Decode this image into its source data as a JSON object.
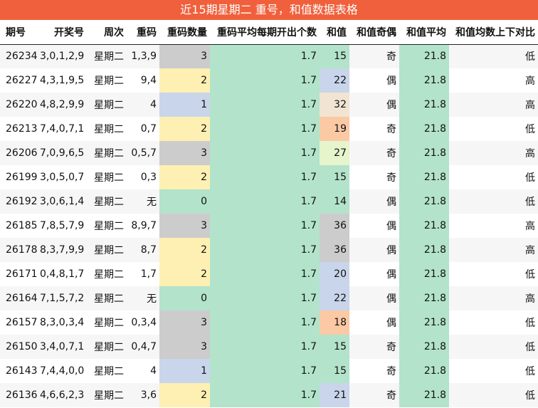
{
  "title": "近15期星期二 重号，和值数据表格",
  "headers": [
    "期号",
    "开奖号",
    "周次",
    "重码",
    "重码数量",
    "重码平均每期开出个数",
    "和值",
    "和值奇偶",
    "和值平均",
    "和值均数上下对比"
  ],
  "colors": {
    "title_bg": "#f0603c",
    "count_0": "#b3e3cb",
    "count_1": "#c9d5ea",
    "count_2": "#fdf0b2",
    "count_3": "#cccccc",
    "avg": "#b3e3cb"
  },
  "rows": [
    {
      "issue": "26234",
      "numbers": "3,0,1,2,9",
      "weekday": "星期二",
      "repeat": "1,3,9",
      "repeat_count": "3",
      "count_color": "#cccccc",
      "avg_count": "1.7",
      "sum": "15",
      "sum_color": "#b3e3cb",
      "parity": "奇",
      "sum_avg": "21.8",
      "compare": "低"
    },
    {
      "issue": "26227",
      "numbers": "4,3,1,9,5",
      "weekday": "星期二",
      "repeat": "9,4",
      "repeat_count": "2",
      "count_color": "#fdf0b2",
      "avg_count": "1.7",
      "sum": "22",
      "sum_color": "#c9d5ea",
      "parity": "偶",
      "sum_avg": "21.8",
      "compare": "高"
    },
    {
      "issue": "26220",
      "numbers": "4,8,2,9,9",
      "weekday": "星期二",
      "repeat": "4",
      "repeat_count": "1",
      "count_color": "#c9d5ea",
      "avg_count": "1.7",
      "sum": "32",
      "sum_color": "#f2e4d2",
      "parity": "偶",
      "sum_avg": "21.8",
      "compare": "高"
    },
    {
      "issue": "26213",
      "numbers": "7,4,0,7,1",
      "weekday": "星期二",
      "repeat": "0,7",
      "repeat_count": "2",
      "count_color": "#fdf0b2",
      "avg_count": "1.7",
      "sum": "19",
      "sum_color": "#fbc9a4",
      "parity": "奇",
      "sum_avg": "21.8",
      "compare": "低"
    },
    {
      "issue": "26206",
      "numbers": "7,0,9,6,5",
      "weekday": "星期二",
      "repeat": "0,5,7",
      "repeat_count": "3",
      "count_color": "#cccccc",
      "avg_count": "1.7",
      "sum": "27",
      "sum_color": "#e6f5cc",
      "parity": "奇",
      "sum_avg": "21.8",
      "compare": "高"
    },
    {
      "issue": "26199",
      "numbers": "3,0,5,0,7",
      "weekday": "星期二",
      "repeat": "0,3",
      "repeat_count": "2",
      "count_color": "#fdf0b2",
      "avg_count": "1.7",
      "sum": "15",
      "sum_color": "#b3e3cb",
      "parity": "奇",
      "sum_avg": "21.8",
      "compare": "低"
    },
    {
      "issue": "26192",
      "numbers": "3,0,6,1,4",
      "weekday": "星期二",
      "repeat": "无",
      "repeat_count": "0",
      "count_color": "#b3e3cb",
      "avg_count": "1.7",
      "sum": "14",
      "sum_color": "#b3e3cb",
      "parity": "偶",
      "sum_avg": "21.8",
      "compare": "低"
    },
    {
      "issue": "26185",
      "numbers": "7,8,5,7,9",
      "weekday": "星期二",
      "repeat": "8,9,7",
      "repeat_count": "3",
      "count_color": "#cccccc",
      "avg_count": "1.7",
      "sum": "36",
      "sum_color": "#cccccc",
      "parity": "偶",
      "sum_avg": "21.8",
      "compare": "高"
    },
    {
      "issue": "26178",
      "numbers": "8,3,7,9,9",
      "weekday": "星期二",
      "repeat": "8,7",
      "repeat_count": "2",
      "count_color": "#fdf0b2",
      "avg_count": "1.7",
      "sum": "36",
      "sum_color": "#cccccc",
      "parity": "偶",
      "sum_avg": "21.8",
      "compare": "高"
    },
    {
      "issue": "26171",
      "numbers": "0,4,8,1,7",
      "weekday": "星期二",
      "repeat": "1,7",
      "repeat_count": "2",
      "count_color": "#fdf0b2",
      "avg_count": "1.7",
      "sum": "20",
      "sum_color": "#c9d5ea",
      "parity": "偶",
      "sum_avg": "21.8",
      "compare": "低"
    },
    {
      "issue": "26164",
      "numbers": "7,1,5,7,2",
      "weekday": "星期二",
      "repeat": "无",
      "repeat_count": "0",
      "count_color": "#b3e3cb",
      "avg_count": "1.7",
      "sum": "22",
      "sum_color": "#c9d5ea",
      "parity": "偶",
      "sum_avg": "21.8",
      "compare": "高"
    },
    {
      "issue": "26157",
      "numbers": "8,3,0,3,4",
      "weekday": "星期二",
      "repeat": "0,3,4",
      "repeat_count": "3",
      "count_color": "#cccccc",
      "avg_count": "1.7",
      "sum": "18",
      "sum_color": "#fbc9a4",
      "parity": "偶",
      "sum_avg": "21.8",
      "compare": "低"
    },
    {
      "issue": "26150",
      "numbers": "3,4,0,7,1",
      "weekday": "星期二",
      "repeat": "0,4,7",
      "repeat_count": "3",
      "count_color": "#cccccc",
      "avg_count": "1.7",
      "sum": "15",
      "sum_color": "#b3e3cb",
      "parity": "奇",
      "sum_avg": "21.8",
      "compare": "低"
    },
    {
      "issue": "26143",
      "numbers": "7,4,4,0,0",
      "weekday": "星期二",
      "repeat": "4",
      "repeat_count": "1",
      "count_color": "#c9d5ea",
      "avg_count": "1.7",
      "sum": "15",
      "sum_color": "#b3e3cb",
      "parity": "奇",
      "sum_avg": "21.8",
      "compare": "低"
    },
    {
      "issue": "26136",
      "numbers": "4,6,6,2,3",
      "weekday": "星期二",
      "repeat": "3,6",
      "repeat_count": "2",
      "count_color": "#fdf0b2",
      "avg_count": "1.7",
      "sum": "21",
      "sum_color": "#c9d5ea",
      "parity": "奇",
      "sum_avg": "21.8",
      "compare": "低"
    }
  ]
}
